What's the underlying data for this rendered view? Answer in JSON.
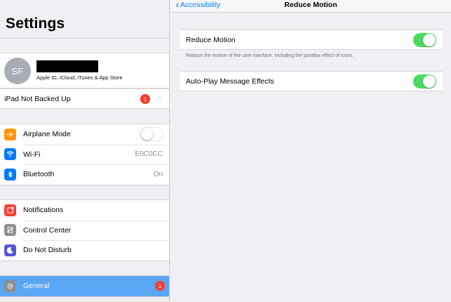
{
  "sidebar": {
    "title": "Settings",
    "profile": {
      "initials": "SF",
      "subtitle": "Apple ID, iCloud, iTunes & App Store"
    },
    "backup": {
      "label": "iPad Not Backed Up",
      "badge": "1"
    },
    "group1": [
      {
        "label": "Airplane Mode",
        "icon": "airplane-icon",
        "color": "#ff9500",
        "value": "",
        "toggle": "off"
      },
      {
        "label": "Wi-Fi",
        "icon": "wifi-icon",
        "color": "#007aff",
        "value": "E0C0CC"
      },
      {
        "label": "Bluetooth",
        "icon": "bluetooth-icon",
        "color": "#007aff",
        "value": "On"
      }
    ],
    "group2": [
      {
        "label": "Notifications",
        "icon": "notifications-icon",
        "color": "#ff3b30"
      },
      {
        "label": "Control Center",
        "icon": "control-center-icon",
        "color": "#8e8e93"
      },
      {
        "label": "Do Not Disturb",
        "icon": "moon-icon",
        "color": "#5856d6"
      }
    ],
    "group3": [
      {
        "label": "General",
        "icon": "gear-icon",
        "color": "#8e8e93",
        "badge": "1",
        "selected": true
      }
    ]
  },
  "detail": {
    "back_label": "Accessibility",
    "title": "Reduce Motion",
    "reduce_motion": {
      "label": "Reduce Motion",
      "state": "on"
    },
    "footnote": "Reduce the motion of the user interface, including the parallax effect of icons.",
    "auto_play": {
      "label": "Auto-Play Message Effects",
      "state": "on"
    }
  },
  "colors": {
    "accent": "#007aff",
    "toggle_on": "#4cd964",
    "badge": "#ff3b30",
    "selected_row": "#5aa6f3"
  }
}
